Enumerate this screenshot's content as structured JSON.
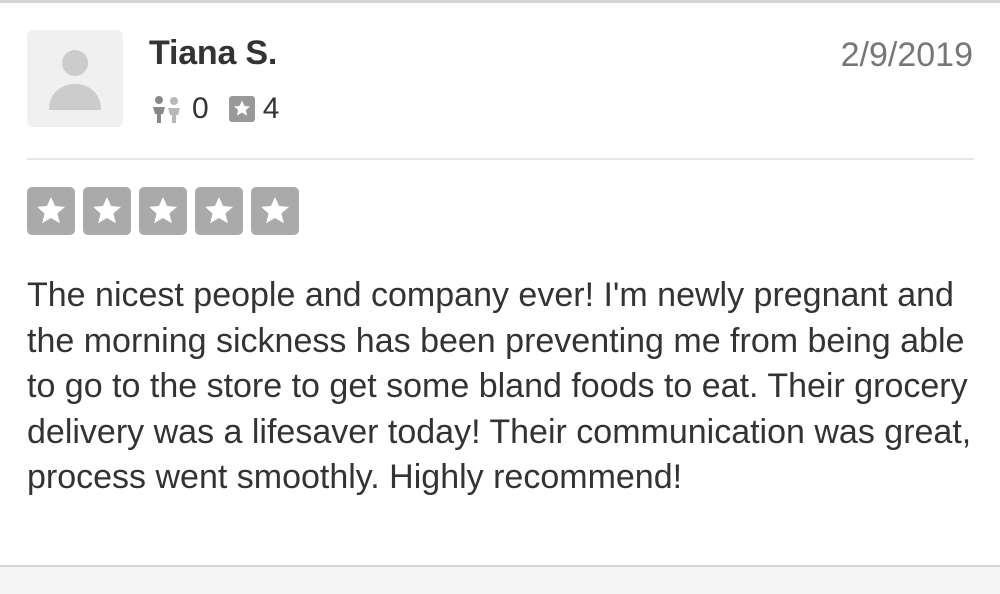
{
  "review": {
    "reviewer": {
      "name": "Tiana S.",
      "avatar_icon": "default-user-icon",
      "friends_icon": "friends-icon",
      "friends_count": "0",
      "reviews_icon": "review-star-icon",
      "reviews_count": "4"
    },
    "date": "2/9/2019",
    "rating": 5,
    "rating_max": 5,
    "rating_color": "#aaaaaa",
    "text": "The nicest people and company ever! I'm newly pregnant and the morning sickness has been preventing me from being able to go to the store to get some bland foods to eat. Their grocery delivery was a lifesaver today! Their communication was great, process went smoothly. Highly recommend!"
  }
}
